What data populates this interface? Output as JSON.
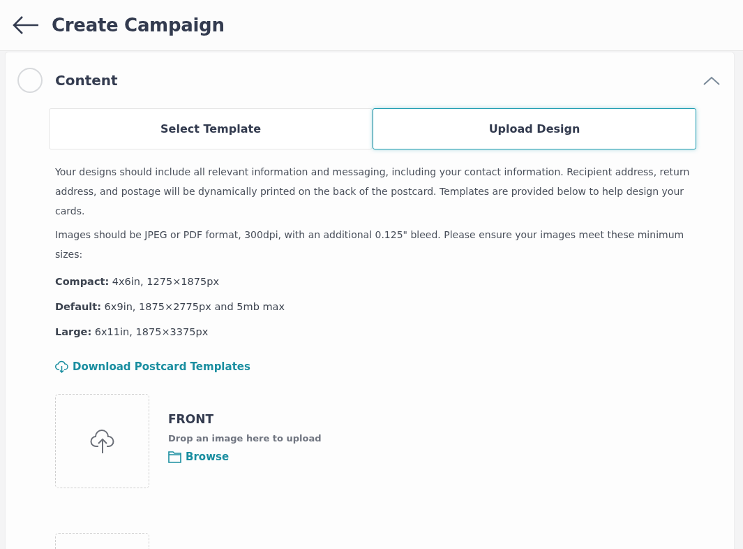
{
  "header": {
    "title": "Create Campaign"
  },
  "section": {
    "title": "Content",
    "completed": false,
    "expanded": true
  },
  "tabs": [
    {
      "label": "Select Template",
      "selected": false
    },
    {
      "label": "Upload Design",
      "selected": true
    }
  ],
  "paragraphs": [
    "Your designs should include all relevant information and messaging, including your contact information. Recipient address, return address, and postage will be dynamically printed on the back of the postcard. Templates are provided below to help design your cards.",
    "Images should be JPEG or PDF format, 300dpi, with an additional 0.125\" bleed. Please ensure your images meet these minimum sizes:"
  ],
  "sizes": [
    "**Compact:** 4x6in, 1275×1875px",
    "**Default:** 6x9in, 1875×2775px and 5mb max",
    "**Large:** 6x11in, 1875×3375px"
  ],
  "download_link": "Download Postcard Templates",
  "uploads": [
    {
      "kind": "labeled",
      "side": "FRONT",
      "hint": "Drop an image here to upload",
      "browse": "Browse"
    },
    {
      "kind": "bare"
    }
  ]
}
